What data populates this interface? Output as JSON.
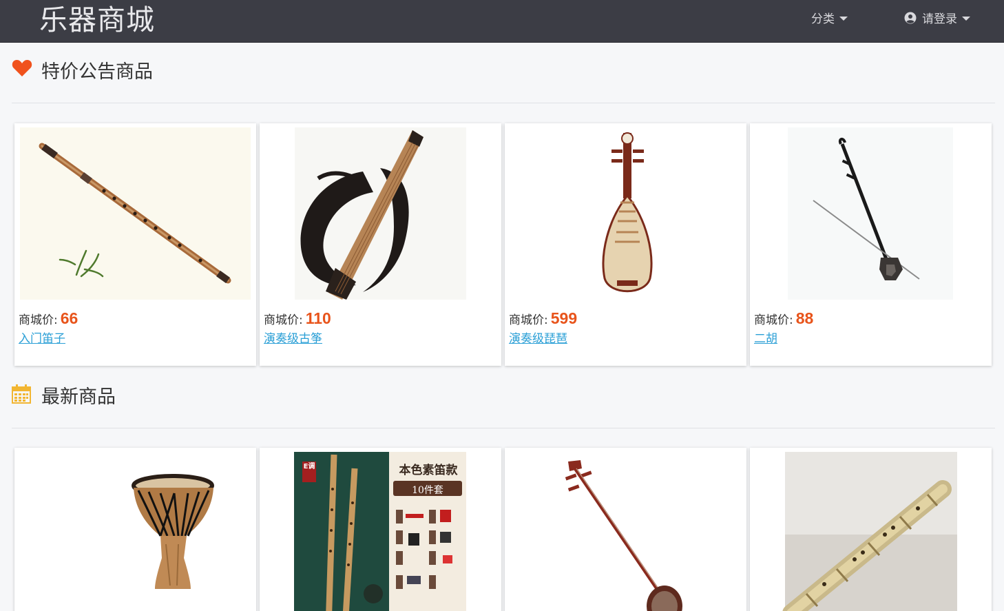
{
  "navbar": {
    "brand": "乐器商城",
    "category_menu": "分类",
    "login_menu": "请登录"
  },
  "sections": [
    {
      "title": "特价公告商品",
      "icon": "heart-icon",
      "icon_color": "#f0521d",
      "products": [
        {
          "price_label": "商城价:",
          "price": "66",
          "name": "入门笛子",
          "image": "bamboo-flute"
        },
        {
          "price_label": "商城价:",
          "price": "110",
          "name": "演奏级古筝",
          "image": "guzheng"
        },
        {
          "price_label": "商城价:",
          "price": "599",
          "name": "演奏级琵琶",
          "image": "pipa"
        },
        {
          "price_label": "商城价:",
          "price": "88",
          "name": "二胡",
          "image": "erhu"
        }
      ]
    },
    {
      "title": "最新商品",
      "icon": "calendar-icon",
      "icon_color": "#f2b632",
      "products": [
        {
          "image": "djembe-drum"
        },
        {
          "image": "flute-set",
          "badge": "E调",
          "header": "本色素笛款",
          "subheader": "10件套"
        },
        {
          "image": "sanxian"
        },
        {
          "image": "bamboo-bawu"
        }
      ]
    }
  ],
  "colors": {
    "navbar": "#3c3d45",
    "price": "#e8541b",
    "link": "#2a9fd6"
  }
}
